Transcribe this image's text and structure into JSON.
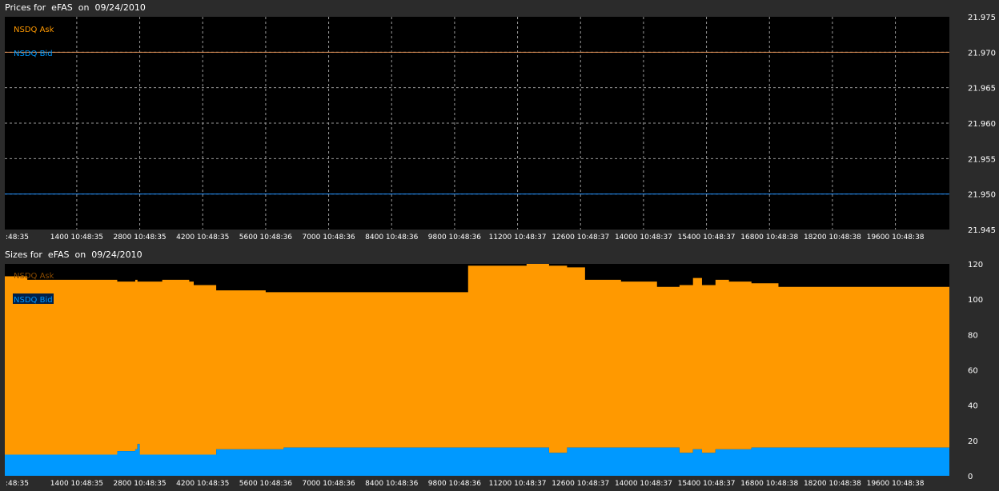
{
  "panels": {
    "prices_title": "Prices for  eFAS  on  09/24/2010",
    "sizes_title": "Sizes for  eFAS  on  09/24/2010"
  },
  "colors": {
    "background": "#2b2b2b",
    "plot_bg": "#000000",
    "grid": "#9a9a9a",
    "ask": "#ff9900",
    "bid": "#0099ff",
    "ask_price_line": "#d2874f",
    "bid_price_line": "#1e90ff"
  },
  "x_tick_labels": [
    ":48:35",
    "1400 10:48:35",
    "2800 10:48:35",
    "4200 10:48:35",
    "5600 10:48:36",
    "7000 10:48:36",
    "8400 10:48:36",
    "9800 10:48:36",
    "11200 10:48:37",
    "12600 10:48:37",
    "14000 10:48:37",
    "15400 10:48:37",
    "16800 10:48:38",
    "18200 10:48:38",
    "19600 10:48:38"
  ],
  "chart_data": [
    {
      "type": "line",
      "title": "Prices for  eFAS  on  09/24/2010",
      "legend": [
        "NSDQ Ask",
        "NSDQ Bid"
      ],
      "legend_placement": "top-left",
      "grid": true,
      "xlim": [
        -200,
        20800
      ],
      "ylim": [
        21.945,
        21.975
      ],
      "y_ticks": [
        21.975,
        21.97,
        21.965,
        21.96,
        21.955,
        21.95,
        21.945
      ],
      "y_tick_labels": [
        "21.975",
        "21.970",
        "21.965",
        "21.960",
        "21.955",
        "21.950",
        "21.945"
      ],
      "series": [
        {
          "name": "NSDQ Ask",
          "x": [
            -200,
            20800
          ],
          "values": [
            21.97,
            21.97
          ]
        },
        {
          "name": "NSDQ Bid",
          "x": [
            -200,
            20800
          ],
          "values": [
            21.95,
            21.95
          ]
        }
      ]
    },
    {
      "type": "area",
      "title": "Sizes for  eFAS  on  09/24/2010",
      "legend": [
        "NSDQ Ask",
        "NSDQ Bid"
      ],
      "legend_placement": "top-left",
      "grid": false,
      "stacked": true,
      "xlim": [
        -200,
        20800
      ],
      "ylim": [
        0,
        120
      ],
      "y_ticks": [
        120,
        100,
        80,
        60,
        40,
        20,
        0
      ],
      "y_tick_labels": [
        "120",
        "100",
        "80",
        "60",
        "40",
        "20",
        "0"
      ],
      "x": [
        -200,
        300,
        900,
        1800,
        2300,
        2700,
        2750,
        2800,
        3300,
        3700,
        3900,
        4000,
        4500,
        5000,
        5600,
        6000,
        6600,
        7400,
        8000,
        8600,
        9300,
        9800,
        10100,
        10600,
        11100,
        11400,
        11600,
        11900,
        12300,
        12700,
        13000,
        13500,
        14000,
        14300,
        14500,
        14800,
        15100,
        15300,
        15600,
        15900,
        16400,
        17000,
        17600,
        18100,
        18700,
        19100,
        19500,
        20000,
        20500,
        20800
      ],
      "series": [
        {
          "name": "NSDQ Bid",
          "values": [
            12,
            12,
            12,
            12,
            14,
            15,
            18,
            12,
            12,
            12,
            12,
            12,
            15,
            15,
            15,
            16,
            16,
            16,
            16,
            16,
            16,
            16,
            16,
            16,
            16,
            16,
            16,
            13,
            16,
            16,
            16,
            16,
            16,
            16,
            16,
            13,
            15,
            13,
            15,
            15,
            16,
            16,
            16,
            16,
            16,
            16,
            16,
            16,
            16,
            16
          ]
        },
        {
          "name": "NSDQ Ask",
          "values": [
            113,
            111,
            111,
            111,
            110,
            111,
            110,
            110,
            111,
            111,
            110,
            108,
            105,
            105,
            104,
            104,
            104,
            104,
            104,
            104,
            104,
            104,
            119,
            119,
            119,
            120,
            120,
            119,
            118,
            111,
            111,
            110,
            110,
            107,
            107,
            108,
            112,
            108,
            111,
            110,
            109,
            107,
            107,
            107,
            107,
            107,
            107,
            107,
            107,
            107
          ]
        }
      ]
    }
  ]
}
